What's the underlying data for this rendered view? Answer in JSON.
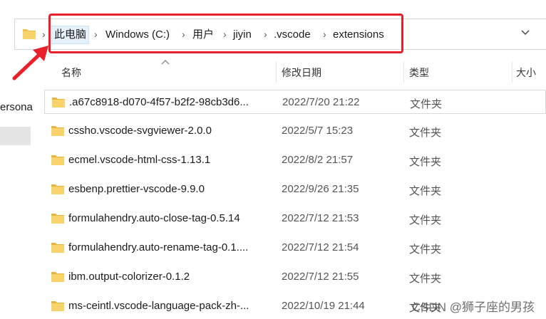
{
  "address_bar": {
    "crumbs": [
      "此电脑",
      "Windows (C:)",
      "用户",
      "jiyin",
      ".vscode",
      "extensions"
    ],
    "separator": "›",
    "expand_icon": "chevron-down-icon"
  },
  "nav": {
    "partial_item": "ersona"
  },
  "columns": {
    "name": "名称",
    "date": "修改日期",
    "type": "类型",
    "size": "大小"
  },
  "rows": [
    {
      "name": ".a67c8918-d070-4f57-b2f2-98cb3d6...",
      "date": "2022/7/20 21:22",
      "type": "文件夹"
    },
    {
      "name": "cssho.vscode-svgviewer-2.0.0",
      "date": "2022/5/7 15:23",
      "type": "文件夹"
    },
    {
      "name": "ecmel.vscode-html-css-1.13.1",
      "date": "2022/8/2 21:57",
      "type": "文件夹"
    },
    {
      "name": "esbenp.prettier-vscode-9.9.0",
      "date": "2022/9/26 21:35",
      "type": "文件夹"
    },
    {
      "name": "formulahendry.auto-close-tag-0.5.14",
      "date": "2022/7/12 21:53",
      "type": "文件夹"
    },
    {
      "name": "formulahendry.auto-rename-tag-0.1....",
      "date": "2022/7/12 21:54",
      "type": "文件夹"
    },
    {
      "name": "ibm.output-colorizer-0.1.2",
      "date": "2022/7/12 21:55",
      "type": "文件夹"
    },
    {
      "name": "ms-ceintl.vscode-language-pack-zh-...",
      "date": "2022/10/19 21:44",
      "type": "文件夹"
    }
  ],
  "watermark": "CSDN @狮子座的男孩",
  "colors": {
    "highlight": "#e8202a",
    "folder": "#f4c04d",
    "selected_crumb": "#e5f1fb"
  }
}
